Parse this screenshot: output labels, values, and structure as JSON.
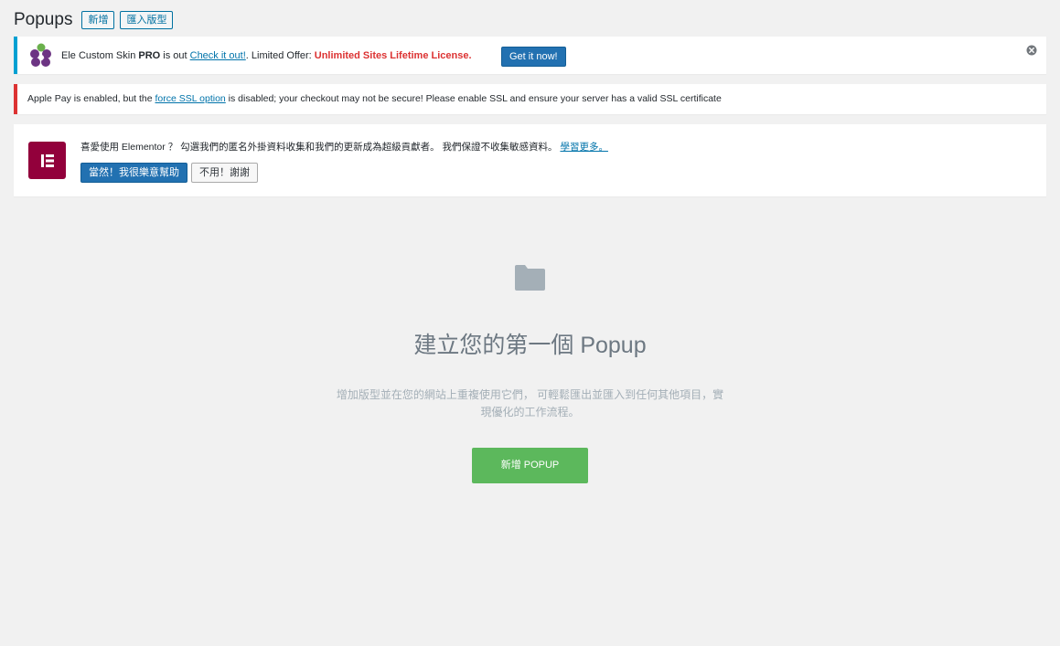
{
  "header": {
    "title": "Popups",
    "add_new_label": "新增",
    "import_label": "匯入版型"
  },
  "notices": {
    "ecs": {
      "text_prefix": "Ele Custom Skin ",
      "text_pro": "PRO",
      "text_is_out": " is out ",
      "link_label": "Check it out!",
      "text_limited": ". Limited Offer: ",
      "offer": "Unlimited Sites Lifetime License.",
      "cta_label": "Get it now!",
      "dismiss_icon": "circle-x-icon"
    },
    "applepay": {
      "text_before": "Apple Pay is enabled, but the ",
      "link_label": "force SSL option",
      "text_after": " is disabled; your checkout may not be secure! Please enable SSL and ensure your server has a valid SSL certificate"
    },
    "elementor": {
      "message": "喜愛使用 Elementor ？ 勾選我們的匿名外掛資料收集和我們的更新成為超級貢獻者。 我們保證不收集敏感資料。 ",
      "learn_more": "學習更多。",
      "accept_label": "當然！我很樂意幫助",
      "decline_label": "不用！謝謝"
    }
  },
  "empty_state": {
    "icon": "folder-icon",
    "title": "建立您的第一個 Popup",
    "description": "增加版型並在您的網站上重複使用它們， 可輕鬆匯出並匯入到任何其他項目，實現優化的工作流程。",
    "cta_label": "新增 POPUP"
  },
  "colors": {
    "background": "#f1f1f1",
    "wp_blue": "#0073aa",
    "info_border": "#00a0d2",
    "error_border": "#dc3232",
    "elementor_brand": "#92003b",
    "success_green": "#5cb85c"
  }
}
